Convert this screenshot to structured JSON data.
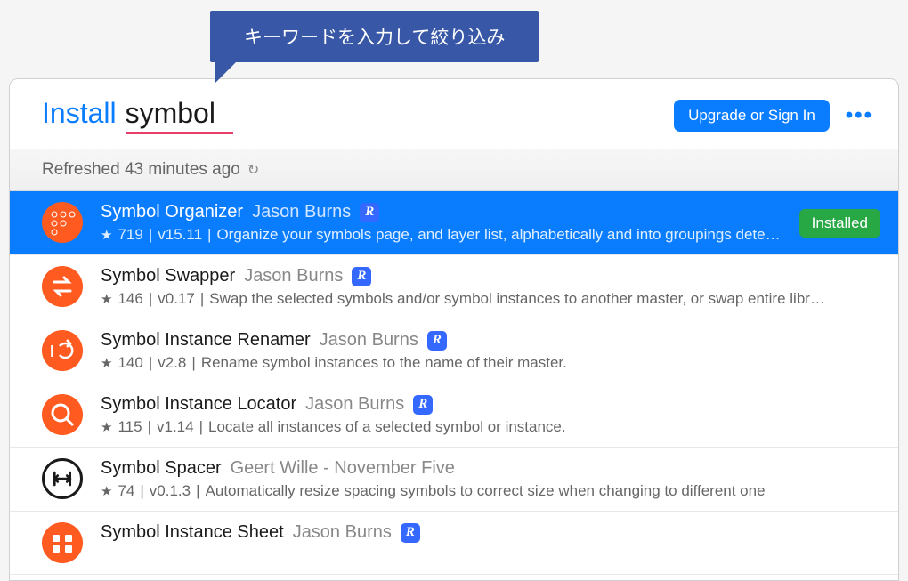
{
  "callout": {
    "text": "キーワードを入力して絞り込み"
  },
  "header": {
    "install_label": "Install",
    "search_term": "symbol",
    "upgrade_label": "Upgrade or Sign In"
  },
  "refresh": {
    "text": "Refreshed 43 minutes ago"
  },
  "plugins": [
    {
      "name": "Symbol Organizer",
      "author": "Jason Burns",
      "stars": "719",
      "version": "v15.11",
      "desc": "Organize your symbols page, and layer list, alphabetically and into groupings dete…",
      "installed_label": "Installed",
      "selected": true,
      "runner": true,
      "icon": "dots"
    },
    {
      "name": "Symbol Swapper",
      "author": "Jason Burns",
      "stars": "146",
      "version": "v0.17",
      "desc": "Swap the selected symbols and/or symbol instances to another master, or swap entire libr…",
      "runner": true,
      "icon": "swap"
    },
    {
      "name": "Symbol Instance Renamer",
      "author": "Jason Burns",
      "stars": "140",
      "version": "v2.8",
      "desc": "Rename symbol instances to the name of their master.",
      "runner": true,
      "icon": "rename"
    },
    {
      "name": "Symbol Instance Locator",
      "author": "Jason Burns",
      "stars": "115",
      "version": "v1.14",
      "desc": "Locate all instances of a selected symbol or instance.",
      "runner": true,
      "icon": "locate"
    },
    {
      "name": "Symbol Spacer",
      "author": "Geert Wille - November Five",
      "stars": "74",
      "version": "v0.1.3",
      "desc": "Automatically resize spacing symbols to correct size when changing to different one",
      "runner": false,
      "icon": "spacer"
    },
    {
      "name": "Symbol Instance Sheet",
      "author": "Jason Burns",
      "stars": "",
      "version": "",
      "desc": "",
      "runner": true,
      "icon": "sheet"
    }
  ]
}
